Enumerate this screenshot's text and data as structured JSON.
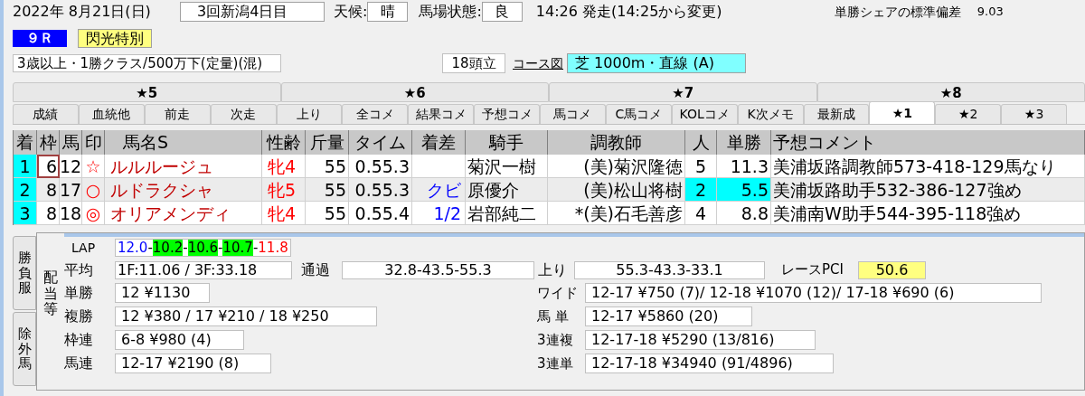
{
  "race_header": {
    "date": "2022年 8月21日(日)",
    "meeting": "3回新潟4日目",
    "weather_label": "天候:",
    "weather": "晴",
    "track_label": "馬場状態:",
    "track": "良",
    "post_time": "14:26 発走(14:25から変更)",
    "share_label": "単勝シェアの標準偏差",
    "share_value": "9.03",
    "race_number": "９Ｒ",
    "race_name": "閃光特別",
    "conditions": "3歳以上・1勝クラス/500万下(定量)(混)",
    "runners": "18頭立",
    "course_link": "コース図",
    "course": "芝 1000m・直線 (A)"
  },
  "tab_groups": [
    {
      "label": "★5",
      "selected": false
    },
    {
      "label": "★6",
      "selected": false
    },
    {
      "label": "★7",
      "selected": false
    },
    {
      "label": "★8",
      "selected": false
    }
  ],
  "tabs": [
    {
      "label": "成績",
      "selected": false
    },
    {
      "label": "血統他",
      "selected": false
    },
    {
      "label": "前走",
      "selected": false
    },
    {
      "label": "次走",
      "selected": false
    },
    {
      "label": "上り",
      "selected": false
    },
    {
      "label": "全コメ",
      "selected": false
    },
    {
      "label": "結果コメ",
      "selected": false
    },
    {
      "label": "予想コメ",
      "selected": false
    },
    {
      "label": "馬コメ",
      "selected": false
    },
    {
      "label": "C馬コメ",
      "selected": false
    },
    {
      "label": "KOLコメ",
      "selected": false
    },
    {
      "label": "K次メモ",
      "selected": false
    },
    {
      "label": "最新成",
      "selected": false
    },
    {
      "label": "★1",
      "selected": true
    },
    {
      "label": "★2",
      "selected": false
    },
    {
      "label": "★3",
      "selected": false
    }
  ],
  "table": {
    "columns": [
      "着",
      "枠",
      "馬",
      "印",
      "馬名S",
      "性齢",
      "斤量",
      "タイム",
      "着差",
      "騎手",
      "調教師",
      "人",
      "単勝",
      "予想コメント"
    ],
    "rows": [
      {
        "selected": false,
        "focused": true,
        "favorite": false,
        "finish": "1",
        "frame": "6",
        "number": "12",
        "mark": "☆",
        "name": "ルルルージュ",
        "sex_age": "牝4",
        "weight": "55",
        "time": "0.55.3",
        "jockey": "菊沢一樹",
        "trainer": "(美)菊沢隆徳",
        "popularity": "5",
        "odds": "11.3",
        "comment": "美浦坂路調教師573-418-129馬なり"
      },
      {
        "selected": true,
        "focused": false,
        "favorite": true,
        "finish": "2",
        "frame": "8",
        "number": "17",
        "mark": "○",
        "name": "ルドラクシャ",
        "sex_age": "牝5",
        "weight": "55",
        "time": "0.55.3",
        "margin": "クビ",
        "jockey": "原優介",
        "trainer": "(美)松山将樹",
        "popularity": "2",
        "odds": "5.5",
        "comment": "美浦坂路助手532-386-127強め"
      },
      {
        "selected": false,
        "focused": false,
        "favorite": false,
        "finish": "3",
        "frame": "8",
        "number": "18",
        "mark": "◎",
        "name": "オリアメンディ",
        "sex_age": "牝4",
        "weight": "55",
        "time": "0.55.4",
        "margin": "1/2",
        "jockey": "岩部純二",
        "trainer": "*(美)石毛善彦",
        "popularity": "4",
        "odds": "8.8",
        "comment": "美浦南W助手544-395-118強め"
      }
    ]
  },
  "side_tabs": [
    {
      "label": "勝負服",
      "selected": false
    },
    {
      "label": "除外馬",
      "selected": false
    }
  ],
  "panel_title": "配当等",
  "results": {
    "lap_label": "LAP",
    "lap_separator": "-",
    "laps": [
      {
        "value": "12.0",
        "kind": "first"
      },
      {
        "value": "10.2",
        "kind": "fast"
      },
      {
        "value": "10.6",
        "kind": "fast"
      },
      {
        "value": "10.7",
        "kind": "fast"
      },
      {
        "value": "11.8",
        "kind": "last"
      }
    ],
    "average_label": "平均",
    "average": "1F:11.06 / 3F:33.18",
    "passing_label": "通過",
    "passing": "32.8-43.5-55.3",
    "final_label": "上り",
    "final": "55.3-43.3-33.1",
    "pci_label": "レースPCI",
    "pci": "50.6",
    "payouts_left": [
      {
        "label": "単勝",
        "value": "12 ¥1130"
      },
      {
        "label": "複勝",
        "value": "12 ¥380 / 17 ¥210 / 18 ¥250"
      },
      {
        "label": "枠連",
        "value": "6-8 ¥980 (4)"
      },
      {
        "label": "馬連",
        "value": "12-17 ¥2190 (8)"
      }
    ],
    "payouts_right": [
      {
        "label": "ワイド",
        "value": "12-17 ¥750 (7)/ 12-18 ¥1070 (12)/ 17-18 ¥690 (6)"
      },
      {
        "label": "馬 単",
        "value": "12-17 ¥5860 (20)"
      },
      {
        "label": "3連複",
        "value": "12-17-18 ¥5290 (13/816)"
      },
      {
        "label": "3連単",
        "value": "12-17-18 ¥34940 (91/4896)"
      }
    ]
  }
}
